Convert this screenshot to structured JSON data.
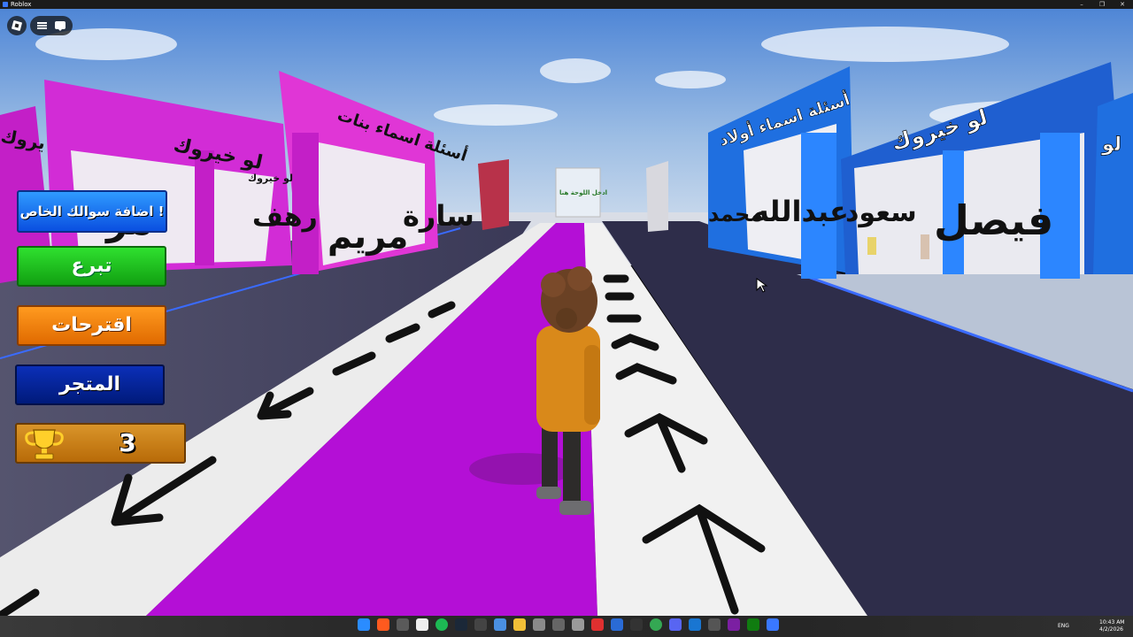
{
  "window": {
    "title": "Roblox"
  },
  "roblox_topbar": {
    "logo_icon": "roblox-logo-icon",
    "menu_icon": "hamburger-icon",
    "chat_icon": "chat-icon"
  },
  "side_buttons": {
    "add_question": "اضافة سوالك الخاص !",
    "donate": "تبرع",
    "suggestions": "اقترحات",
    "shop": "المتجر"
  },
  "wins": {
    "icon": "trophy-icon",
    "count": "3"
  },
  "world_signs": {
    "left_gate_1": "لو خيروك",
    "left_gate_2": "أسئلة اسماء بنات",
    "left_edge_sign": "يروك",
    "right_gate_1": "أسئلة اسماء أولاد",
    "right_gate_2": "لو خيروك",
    "right_edge_sign": "لو",
    "left_names": [
      "مريم",
      "سارة",
      "رهف",
      "مر"
    ],
    "right_names": [
      "فيصل",
      "سعود",
      "عبدالله",
      "محمد"
    ],
    "small_sign_left": "لو خيروك",
    "far_board": "ادخل اللوحة هنا"
  },
  "tray": {
    "lang": "ENG",
    "time": "10:43 AM",
    "date": "4/2/2026"
  },
  "colors": {
    "magenta": "#d22cd6",
    "blue": "#1f6fe0",
    "floor": "#3b3a56",
    "sky": "#5d8fd6"
  }
}
